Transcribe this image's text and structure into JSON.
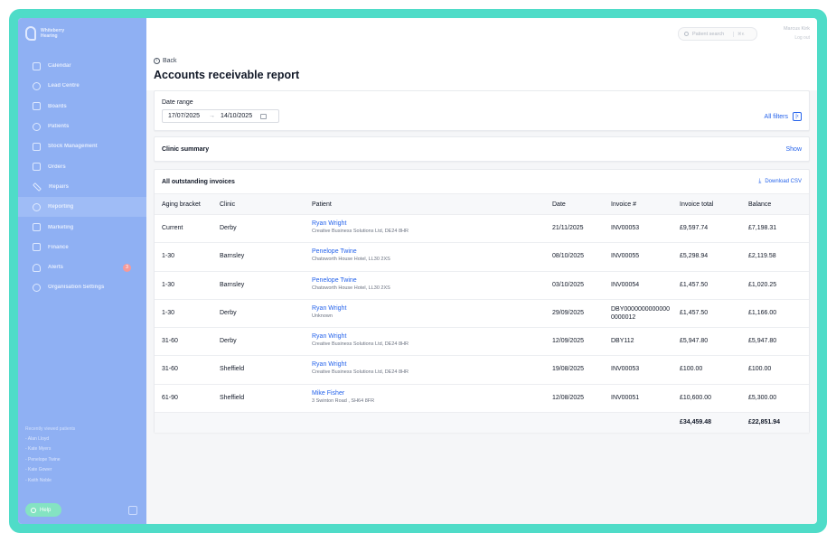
{
  "sidebar": {
    "brand": [
      "Whiteberry",
      "Hearing"
    ],
    "items": [
      {
        "label": "Calendar",
        "icon": "calendar-icon"
      },
      {
        "label": "Lead Centre",
        "icon": "headset-icon"
      },
      {
        "label": "Boards",
        "icon": "board-icon"
      },
      {
        "label": "Patients",
        "icon": "user-icon"
      },
      {
        "label": "Stock Management",
        "icon": "box-icon"
      },
      {
        "label": "Orders",
        "icon": "orders-icon"
      },
      {
        "label": "Repairs",
        "icon": "wrench-icon"
      },
      {
        "label": "Reporting",
        "icon": "chart-icon",
        "active": true
      },
      {
        "label": "Marketing",
        "icon": "megaphone-icon"
      },
      {
        "label": "Finance",
        "icon": "finance-icon"
      },
      {
        "label": "Alerts",
        "icon": "bell-icon",
        "badge": "3"
      },
      {
        "label": "Organisation Settings",
        "icon": "gear-icon"
      }
    ],
    "recent_title": "Recently viewed patients",
    "recent": [
      "- Alan Lloyd",
      "- Kate Myers",
      "- Penelope Twine",
      "- Kate Gower",
      "- Keith Noble"
    ],
    "help_label": "Help"
  },
  "topbar": {
    "search_placeholder": "Patient search",
    "search_shortcut": "⌘K",
    "user_name": "Marcus Kirk",
    "logout_label": "Log out"
  },
  "header": {
    "back_label": "Back",
    "title": "Accounts receivable report"
  },
  "filters": {
    "date_range_label": "Date range",
    "date_from": "17/07/2025",
    "date_to": "14/10/2025",
    "all_filters_label": "All filters"
  },
  "summary": {
    "title": "Clinic summary",
    "show_label": "Show"
  },
  "invoices": {
    "title": "All outstanding invoices",
    "download_label": "Download CSV",
    "columns": [
      "Aging bracket",
      "Clinic",
      "Patient",
      "Date",
      "Invoice #",
      "Invoice total",
      "Balance"
    ],
    "rows": [
      {
        "aging": "Current",
        "clinic": "Derby",
        "patient": "Ryan Wright",
        "address": "Creative Business Solutions Ltd, DE24 8HR",
        "date": "21/11/2025",
        "invoice": "INV00053",
        "total": "£9,597.74",
        "balance": "£7,198.31"
      },
      {
        "aging": "1-30",
        "clinic": "Barnsley",
        "patient": "Penelope Twine",
        "address": "Chatsworth House Hotel, LL30 2XS",
        "date": "08/10/2025",
        "invoice": "INV00055",
        "total": "£5,298.94",
        "balance": "£2,119.58"
      },
      {
        "aging": "1-30",
        "clinic": "Barnsley",
        "patient": "Penelope Twine",
        "address": "Chatsworth House Hotel, LL30 2XS",
        "date": "03/10/2025",
        "invoice": "INV00054",
        "total": "£1,457.50",
        "balance": "£1,020.25"
      },
      {
        "aging": "1-30",
        "clinic": "Derby",
        "patient": "Ryan Wright",
        "address": "Unknown",
        "date": "29/09/2025",
        "invoice": "DBY00000000000000000012",
        "total": "£1,457.50",
        "balance": "£1,166.00"
      },
      {
        "aging": "31-60",
        "clinic": "Derby",
        "patient": "Ryan Wright",
        "address": "Creative Business Solutions Ltd, DE24 8HR",
        "date": "12/09/2025",
        "invoice": "DBY112",
        "total": "£5,947.80",
        "balance": "£5,947.80"
      },
      {
        "aging": "31-60",
        "clinic": "Sheffield",
        "patient": "Ryan Wright",
        "address": "Creative Business Solutions Ltd, DE24 8HR",
        "date": "19/08/2025",
        "invoice": "INV00053",
        "total": "£100.00",
        "balance": "£100.00"
      },
      {
        "aging": "61-90",
        "clinic": "Sheffield",
        "patient": "Mike Fisher",
        "address": "3 Swinton Road , SH64 8FR",
        "date": "12/08/2025",
        "invoice": "INV00051",
        "total": "£10,600.00",
        "balance": "£5,300.00"
      }
    ],
    "totals": {
      "total": "£34,459.48",
      "balance": "£22,851.94"
    }
  }
}
